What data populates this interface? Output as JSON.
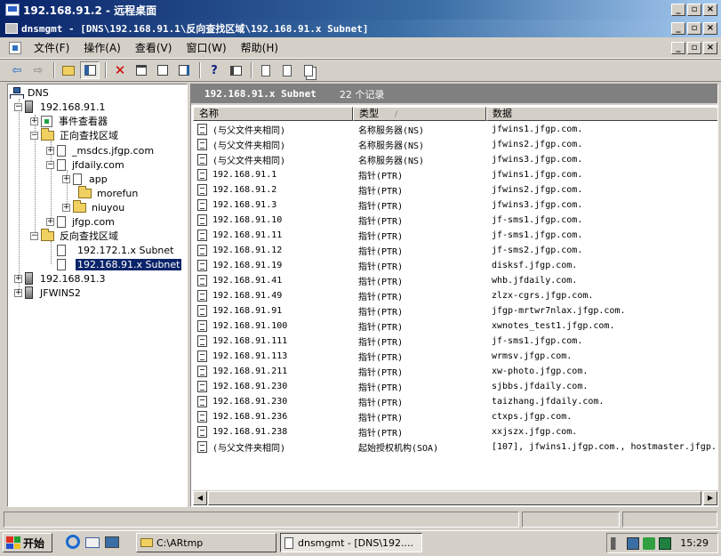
{
  "window": {
    "title": "192.168.91.2 - 远程桌面",
    "inner_title": "dnsmgmt - [DNS\\192.168.91.1\\反向查找区域\\192.168.91.x Subnet]"
  },
  "menu": [
    "文件(F)",
    "操作(A)",
    "查看(V)",
    "窗口(W)",
    "帮助(H)"
  ],
  "toolbar_icons": [
    "back-arrow-icon",
    "forward-arrow-icon",
    "up-folder-icon",
    "show-tree-icon",
    "delete-icon",
    "properties-icon",
    "refresh-icon",
    "export-icon",
    "help-icon",
    "console-icon",
    "record-icon",
    "record-list-icon",
    "copy-icon"
  ],
  "tree": {
    "root": "DNS",
    "server1": "192.168.91.1",
    "event_viewer": "事件查看器",
    "forward_zone": "正向查找区域",
    "msdcs": "_msdcs.jfgp.com",
    "jfdaily": "jfdaily.com",
    "app": "app",
    "morefun": "morefun",
    "niuyou": "niuyou",
    "jfgp": "jfgp.com",
    "reverse_zone": "反向查找区域",
    "subnet172": "192.172.1.x Subnet",
    "subnet91": "192.168.91.x Subnet",
    "server2": "192.168.91.3",
    "server3": "JFWINS2"
  },
  "details": {
    "header_title": "192.168.91.x Subnet",
    "record_count": "22 个记录",
    "columns": [
      "名称",
      "类型",
      "数据"
    ],
    "sort_indicator": "/",
    "rows": [
      [
        "(与父文件夹相同)",
        "名称服务器(NS)",
        "jfwins1.jfgp.com."
      ],
      [
        "(与父文件夹相同)",
        "名称服务器(NS)",
        "jfwins2.jfgp.com."
      ],
      [
        "(与父文件夹相同)",
        "名称服务器(NS)",
        "jfwins3.jfgp.com."
      ],
      [
        "192.168.91.1",
        "指针(PTR)",
        "jfwins1.jfgp.com."
      ],
      [
        "192.168.91.2",
        "指针(PTR)",
        "jfwins2.jfgp.com."
      ],
      [
        "192.168.91.3",
        "指针(PTR)",
        "jfwins3.jfgp.com."
      ],
      [
        "192.168.91.10",
        "指针(PTR)",
        "jf-sms1.jfgp.com."
      ],
      [
        "192.168.91.11",
        "指针(PTR)",
        "jf-sms1.jfgp.com."
      ],
      [
        "192.168.91.12",
        "指针(PTR)",
        "jf-sms2.jfgp.com."
      ],
      [
        "192.168.91.19",
        "指针(PTR)",
        "disksf.jfgp.com."
      ],
      [
        "192.168.91.41",
        "指针(PTR)",
        "whb.jfdaily.com."
      ],
      [
        "192.168.91.49",
        "指针(PTR)",
        "zlzx-cgrs.jfgp.com."
      ],
      [
        "192.168.91.91",
        "指针(PTR)",
        "jfgp-mrtwr7nlax.jfgp.com."
      ],
      [
        "192.168.91.100",
        "指针(PTR)",
        "xwnotes_test1.jfgp.com."
      ],
      [
        "192.168.91.111",
        "指针(PTR)",
        "jf-sms1.jfgp.com."
      ],
      [
        "192.168.91.113",
        "指针(PTR)",
        "wrmsv.jfgp.com."
      ],
      [
        "192.168.91.211",
        "指针(PTR)",
        "xw-photo.jfgp.com."
      ],
      [
        "192.168.91.230",
        "指针(PTR)",
        "sjbbs.jfdaily.com."
      ],
      [
        "192.168.91.230",
        "指针(PTR)",
        "taizhang.jfdaily.com."
      ],
      [
        "192.168.91.236",
        "指针(PTR)",
        "ctxps.jfgp.com."
      ],
      [
        "192.168.91.238",
        "指针(PTR)",
        "xxjszx.jfgp.com."
      ],
      [
        "(与父文件夹相同)",
        "起始授权机构(SOA)",
        "[107], jfwins1.jfgp.com., hostmaster.jfgp."
      ]
    ]
  },
  "taskbar": {
    "start": "开始",
    "task1": "C:\\ARtmp",
    "task2": "dnsmgmt - [DNS\\192....",
    "clock": "15:29"
  },
  "colors": {
    "title_start": "#0a246a",
    "title_end": "#a6caf0",
    "face": "#d4d0c8",
    "selection": "#0a246a"
  }
}
